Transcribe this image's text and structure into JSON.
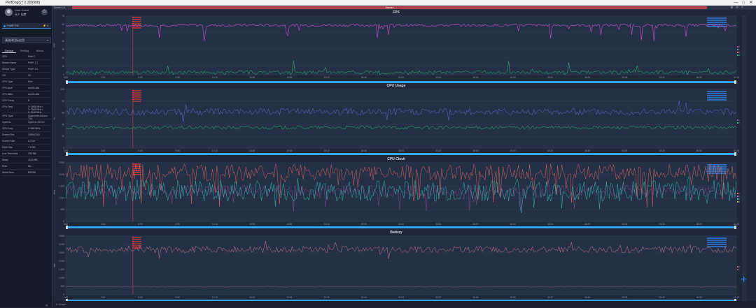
{
  "app": {
    "title": "PerfDog(v7.0.200988)",
    "controls": [
      "—",
      "□",
      "✕"
    ]
  },
  "sidebar": {
    "user_label": "User Guest",
    "user_name": "玩 F 出席  ",
    "device": "P40P-TG",
    "app_selector": "请选择目标应用",
    "tabs": [
      "Device",
      "Setting",
      "About"
    ],
    "info": [
      {
        "k": "GPU",
        "v": "Mali-G"
      },
      {
        "k": "Device Name",
        "v": "P40P-TG"
      },
      {
        "k": "Device Type",
        "v": "P40P-TG"
      },
      {
        "k": "OS",
        "v": "10"
      },
      {
        "k": "CPU Type",
        "v": "Kirin"
      },
      {
        "k": "CPU Arch",
        "v": "arm64-v8a"
      },
      {
        "k": "CPU ABIs",
        "v": "arm64-v8a"
      },
      {
        "k": "CPU Cores",
        "v": "8"
      },
      {
        "k": "CPU Freq",
        "v": "0~1805 MHz / 0~2363 MHz / 0~3130 MHz"
      },
      {
        "k": "GPU Type",
        "v": "Qualcomm Adreno 740"
      },
      {
        "k": "OpenGL",
        "v": "OpenGL ES 3.2"
      },
      {
        "k": "GPU Freq",
        "v": "0~850 MHz"
      },
      {
        "k": "Screen Res",
        "v": "1080x2340"
      },
      {
        "k": "Screen Size",
        "v": "6.72 in"
      },
      {
        "k": "RAM Size",
        "v": "7.6 GB"
      },
      {
        "k": "Low Threshold",
        "v": "256 MB"
      },
      {
        "k": "Swap",
        "v": "2048 MB"
      },
      {
        "k": "Root",
        "v": "No"
      },
      {
        "k": "Serial Num",
        "v": "8GKD6"
      }
    ]
  },
  "main": {
    "scene_label": "Scene:1:0",
    "divider_label": "Scene1",
    "bottom_label": "0 Graph"
  },
  "x_ticks": [
    "0:00",
    "3:00",
    "6:30",
    "9:55",
    "13:10",
    "16:35",
    "19:55",
    "23:15",
    "26:45",
    "30:05",
    "33:20",
    "36:40",
    "40:00",
    "43:20",
    "46:45",
    "50:05",
    "53:25",
    "56:50",
    "61:25"
  ],
  "panels": [
    {
      "title": "FPS",
      "yticks": [
        "0",
        "10",
        "20",
        "30",
        "40",
        "50",
        "60",
        "70"
      ],
      "ylabel": "FPS"
    },
    {
      "title": "CPU Usage",
      "yticks": [
        "0",
        "20",
        "40",
        "60",
        "80",
        "100"
      ],
      "ylabel": "%"
    },
    {
      "title": "CPU Clock",
      "yticks": [
        "0",
        "500",
        "1,000",
        "1,500",
        "2,000",
        "2,500"
      ],
      "ylabel": "MHz"
    },
    {
      "title": "Battery",
      "yticks": [
        "0",
        "500",
        "1,000",
        "1,500",
        "2,000",
        "2,500",
        "3,000",
        "3,500"
      ],
      "ylabel": "mW"
    }
  ],
  "legends": {
    "fps": [
      {
        "n": "FPS",
        "c": "#d050d0"
      },
      {
        "n": "Jank",
        "c": "#7a8da8"
      },
      {
        "n": "Stutter",
        "c": "#ff7a5a"
      },
      {
        "n": "FTime",
        "c": "#2ecc71"
      }
    ],
    "cpu": [
      {
        "n": "AppCPU",
        "c": "#6b6dd6"
      },
      {
        "n": "TotalCPU",
        "c": "#2ecc71"
      }
    ],
    "clock": [
      {
        "n": "CPU0",
        "c": "#ff6f61"
      },
      {
        "n": "CPU1",
        "c": "#e06bd6"
      },
      {
        "n": "CPU2",
        "c": "#2ed6c4"
      },
      {
        "n": "CPU3",
        "c": "#c6d43c"
      }
    ],
    "battery": [
      {
        "n": "Power",
        "c": "#d07a88"
      },
      {
        "n": "Current",
        "c": "#8d5a7a"
      }
    ]
  },
  "chart_data": [
    {
      "type": "line",
      "title": "FPS",
      "ylim": [
        0,
        70
      ],
      "series": [
        {
          "name": "FPS",
          "typical": 59
        },
        {
          "name": "FTime",
          "typical": 3
        }
      ]
    },
    {
      "type": "line",
      "title": "CPU Usage",
      "ylim": [
        0,
        100
      ],
      "series": [
        {
          "name": "AppCPU",
          "typical": 62
        },
        {
          "name": "TotalCPU",
          "typical": 35
        }
      ]
    },
    {
      "type": "line",
      "title": "CPU Clock",
      "ylim": [
        0,
        2500
      ],
      "series": [
        {
          "name": "CPU0",
          "typical": 2100
        },
        {
          "name": "CPU2",
          "typical": 1300
        }
      ]
    },
    {
      "type": "line",
      "title": "Battery",
      "ylim": [
        0,
        3500
      ],
      "series": [
        {
          "name": "Power",
          "typical": 2700
        },
        {
          "name": "Current",
          "typical": 480
        }
      ]
    }
  ]
}
